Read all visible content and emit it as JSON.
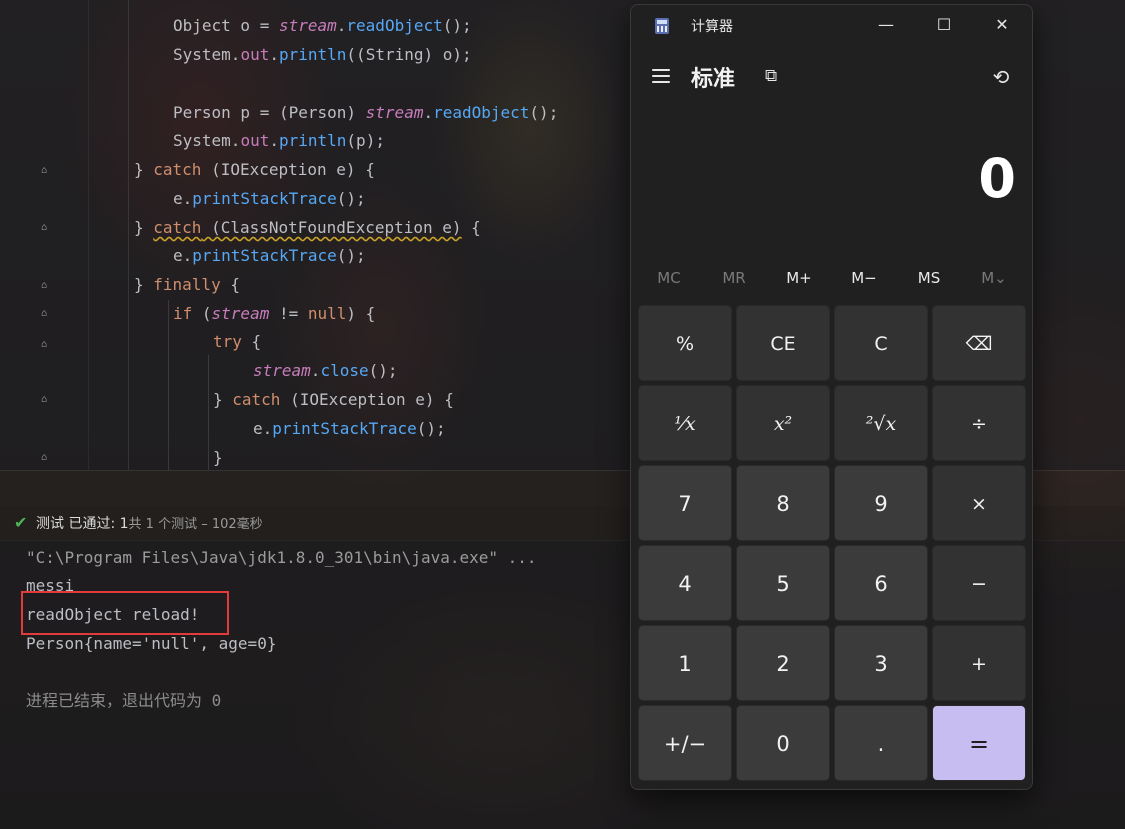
{
  "editor": {
    "lines": [
      {
        "parts": [
          {
            "t": "Object o = ",
            "c": "cls"
          },
          {
            "t": "stream",
            "c": "it"
          },
          {
            "t": ".",
            "c": "cls"
          },
          {
            "t": "readObject",
            "c": "fn"
          },
          {
            "t": "();",
            "c": "cls"
          }
        ]
      },
      {
        "parts": [
          {
            "t": "System.",
            "c": "cls"
          },
          {
            "t": "out",
            "c": "fld"
          },
          {
            "t": ".",
            "c": "cls"
          },
          {
            "t": "println",
            "c": "fn"
          },
          {
            "t": "((String) o);",
            "c": "cls"
          }
        ]
      },
      {
        "parts": []
      },
      {
        "parts": [
          {
            "t": "Person p = (Person) ",
            "c": "cls"
          },
          {
            "t": "stream",
            "c": "it"
          },
          {
            "t": ".",
            "c": "cls"
          },
          {
            "t": "readObject",
            "c": "fn"
          },
          {
            "t": "();",
            "c": "cls"
          }
        ]
      },
      {
        "parts": [
          {
            "t": "System.",
            "c": "cls"
          },
          {
            "t": "out",
            "c": "fld"
          },
          {
            "t": ".",
            "c": "cls"
          },
          {
            "t": "println",
            "c": "fn"
          },
          {
            "t": "(p);",
            "c": "cls"
          }
        ]
      },
      {
        "parts": [
          {
            "t": "} ",
            "c": "cls"
          },
          {
            "t": "catch",
            "c": "kw"
          },
          {
            "t": " (IOException e) {",
            "c": "cls"
          }
        ]
      },
      {
        "parts": [
          {
            "t": "e.",
            "c": "cls"
          },
          {
            "t": "printStackTrace",
            "c": "fn"
          },
          {
            "t": "();",
            "c": "cls"
          }
        ]
      },
      {
        "parts": [
          {
            "t": "} ",
            "c": "cls"
          },
          {
            "t": "catch",
            "c": "kw warn"
          },
          {
            "t": " (ClassNotFoundException e)",
            "c": "cls warn"
          },
          {
            "t": " {",
            "c": "cls"
          }
        ]
      },
      {
        "parts": [
          {
            "t": "e.",
            "c": "cls"
          },
          {
            "t": "printStackTrace",
            "c": "fn"
          },
          {
            "t": "();",
            "c": "cls"
          }
        ]
      },
      {
        "parts": [
          {
            "t": "} ",
            "c": "cls"
          },
          {
            "t": "finally",
            "c": "kw"
          },
          {
            "t": " {",
            "c": "cls"
          }
        ]
      },
      {
        "parts": [
          {
            "t": "if",
            "c": "kw"
          },
          {
            "t": " (",
            "c": "cls"
          },
          {
            "t": "stream",
            "c": "it"
          },
          {
            "t": " != ",
            "c": "cls"
          },
          {
            "t": "null",
            "c": "kw"
          },
          {
            "t": ") {",
            "c": "cls"
          }
        ]
      },
      {
        "parts": [
          {
            "t": "try",
            "c": "kw"
          },
          {
            "t": " {",
            "c": "cls"
          }
        ]
      },
      {
        "parts": [
          {
            "t": "stream",
            "c": "it"
          },
          {
            "t": ".",
            "c": "cls"
          },
          {
            "t": "close",
            "c": "fn"
          },
          {
            "t": "();",
            "c": "cls"
          }
        ]
      },
      {
        "parts": [
          {
            "t": "} ",
            "c": "cls"
          },
          {
            "t": "catch",
            "c": "kw"
          },
          {
            "t": " (IOException e) {",
            "c": "cls"
          }
        ]
      },
      {
        "parts": [
          {
            "t": "e.",
            "c": "cls"
          },
          {
            "t": "printStackTrace",
            "c": "fn"
          },
          {
            "t": "();",
            "c": "cls"
          }
        ]
      },
      {
        "parts": [
          {
            "t": "}",
            "c": "cls"
          }
        ]
      }
    ]
  },
  "test_status": {
    "label": "测试 已通过: ",
    "passed": "1",
    "detail": "共 1 个测试 – 102毫秒"
  },
  "console": {
    "command": "\"C:\\Program Files\\Java\\jdk1.8.0_301\\bin\\java.exe\" ...",
    "out1": "messi",
    "out2": "readObject reload!",
    "out3": "Person{name='null', age=0}",
    "exit": "进程已结束，退出代码为 0"
  },
  "calculator": {
    "title": "计算器",
    "mode": "标准",
    "display": "0",
    "memory": [
      {
        "label": "MC",
        "enabled": false
      },
      {
        "label": "MR",
        "enabled": false
      },
      {
        "label": "M+",
        "enabled": true
      },
      {
        "label": "M−",
        "enabled": true
      },
      {
        "label": "MS",
        "enabled": true
      },
      {
        "label": "M⌄",
        "enabled": false
      }
    ],
    "keys": [
      {
        "id": "percent",
        "label": "%",
        "type": "op"
      },
      {
        "id": "ce",
        "label": "CE",
        "type": "op"
      },
      {
        "id": "c",
        "label": "C",
        "type": "op"
      },
      {
        "id": "backspace",
        "label": "⌫",
        "type": "op"
      },
      {
        "id": "reciprocal",
        "label": "¹⁄x",
        "type": "op-serif"
      },
      {
        "id": "square",
        "label": "x²",
        "type": "op-serif"
      },
      {
        "id": "sqrt",
        "label": "²√x",
        "type": "op-serif"
      },
      {
        "id": "divide",
        "label": "÷",
        "type": "op"
      },
      {
        "id": "7",
        "label": "7",
        "type": "num"
      },
      {
        "id": "8",
        "label": "8",
        "type": "num"
      },
      {
        "id": "9",
        "label": "9",
        "type": "num"
      },
      {
        "id": "multiply",
        "label": "×",
        "type": "op"
      },
      {
        "id": "4",
        "label": "4",
        "type": "num"
      },
      {
        "id": "5",
        "label": "5",
        "type": "num"
      },
      {
        "id": "6",
        "label": "6",
        "type": "num"
      },
      {
        "id": "minus",
        "label": "−",
        "type": "op"
      },
      {
        "id": "1",
        "label": "1",
        "type": "num"
      },
      {
        "id": "2",
        "label": "2",
        "type": "num"
      },
      {
        "id": "3",
        "label": "3",
        "type": "num"
      },
      {
        "id": "plus",
        "label": "+",
        "type": "op"
      },
      {
        "id": "negate",
        "label": "+/−",
        "type": "num"
      },
      {
        "id": "0",
        "label": "0",
        "type": "num"
      },
      {
        "id": "decimal",
        "label": ".",
        "type": "num"
      },
      {
        "id": "equals",
        "label": "=",
        "type": "eq"
      }
    ]
  }
}
